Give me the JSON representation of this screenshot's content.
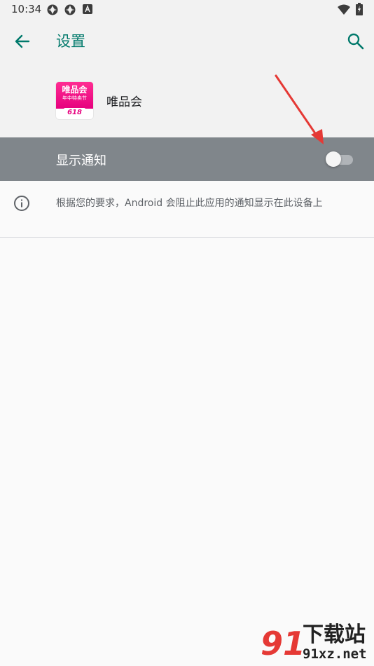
{
  "status_bar": {
    "time": "10:34"
  },
  "app_bar": {
    "title": "设置"
  },
  "app_info": {
    "name": "唯品会",
    "icon_brand": "唯品会",
    "icon_sub": "年中特卖节",
    "icon_num": "618"
  },
  "notifications": {
    "label": "显示通知",
    "enabled": false
  },
  "info": {
    "text": "根据您的要求，Android 会阻止此应用的通知显示在此设备上"
  },
  "watermark": {
    "logo": "91",
    "title": "下载站",
    "domain": "91xz.net"
  },
  "colors": {
    "accent": "#00796b",
    "highlight_row": "#80868b",
    "arrow": "#e53935"
  }
}
